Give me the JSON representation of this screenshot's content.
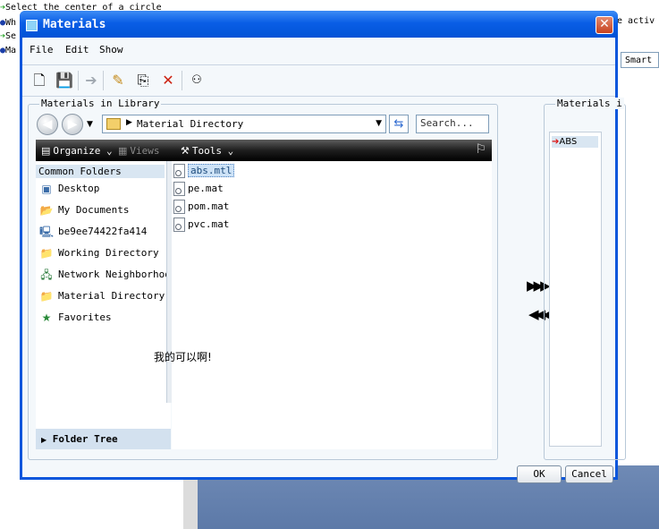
{
  "background": {
    "messages": [
      {
        "icon": "arrow",
        "text": "Select the center of a circle"
      },
      {
        "icon": "dot",
        "text": "Wh"
      },
      {
        "icon": "arrow",
        "text": "Se"
      },
      {
        "icon": "dot",
        "text": "Ma"
      }
    ],
    "right_text": "e activ",
    "smart_field": "Smart"
  },
  "dialog": {
    "title": "Materials",
    "close_glyph": "✕",
    "menu": [
      "File",
      "Edit",
      "Show"
    ],
    "library_group_label": "Materials in Library",
    "model_group_label": "Materials i",
    "address": {
      "path": "Material Directory",
      "search_placeholder": "Search..."
    },
    "commands": {
      "organize": "Organize",
      "views": "Views",
      "tools": "Tools"
    },
    "nav_header": "Common Folders",
    "nav_items": [
      {
        "label": "Desktop",
        "icon": "desktop-icon"
      },
      {
        "label": "My Documents",
        "icon": "documents-icon"
      },
      {
        "label": "be9ee74422fa414",
        "icon": "computer-icon"
      },
      {
        "label": "Working Directory",
        "icon": "folder-icon"
      },
      {
        "label": "Network Neighborhood",
        "icon": "network-icon"
      },
      {
        "label": "Material Directory",
        "icon": "folder-icon"
      },
      {
        "label": "Favorites",
        "icon": "favorites-icon"
      }
    ],
    "folder_tree_label": "Folder Tree",
    "files": [
      {
        "name": "abs.mtl",
        "selected": true
      },
      {
        "name": "pe.mat",
        "selected": false
      },
      {
        "name": "pom.mat",
        "selected": false
      },
      {
        "name": "pvc.mat",
        "selected": false
      }
    ],
    "overlay_text": "我的可以啊!",
    "model_materials": [
      {
        "name": "ABS"
      }
    ],
    "buttons": {
      "add": "▶▶▶",
      "remove": "◀◀◀",
      "ok": "OK",
      "cancel": "Cancel"
    }
  }
}
